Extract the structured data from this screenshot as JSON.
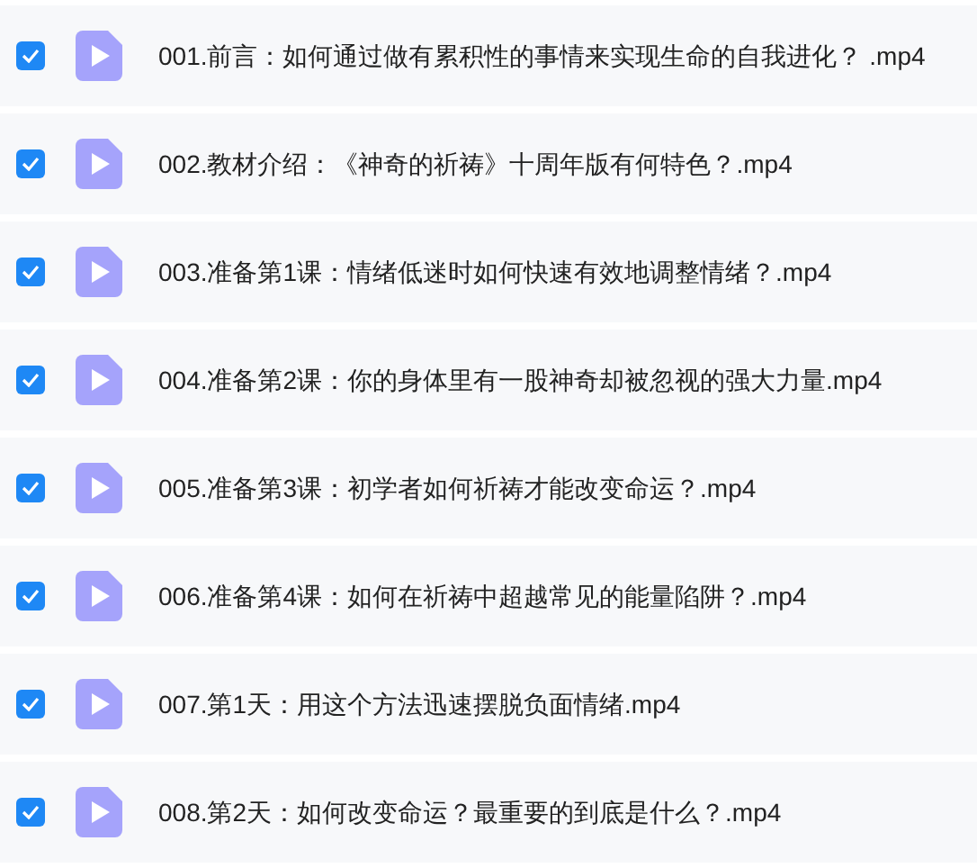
{
  "files": [
    {
      "name": "001.前言：如何通过做有累积性的事情来实现生命的自我进化？ .mp4",
      "checked": true
    },
    {
      "name": "002.教材介绍：《神奇的祈祷》十周年版有何特色？.mp4",
      "checked": true
    },
    {
      "name": "003.准备第1课：情绪低迷时如何快速有效地调整情绪？.mp4",
      "checked": true
    },
    {
      "name": "004.准备第2课：你的身体里有一股神奇却被忽视的强大力量.mp4",
      "checked": true
    },
    {
      "name": "005.准备第3课：初学者如何祈祷才能改变命运？.mp4",
      "checked": true
    },
    {
      "name": "006.准备第4课：如何在祈祷中超越常见的能量陷阱？.mp4",
      "checked": true
    },
    {
      "name": "007.第1天：用这个方法迅速摆脱负面情绪.mp4",
      "checked": true
    },
    {
      "name": "008.第2天：如何改变命运？最重要的到底是什么？.mp4",
      "checked": true
    }
  ]
}
